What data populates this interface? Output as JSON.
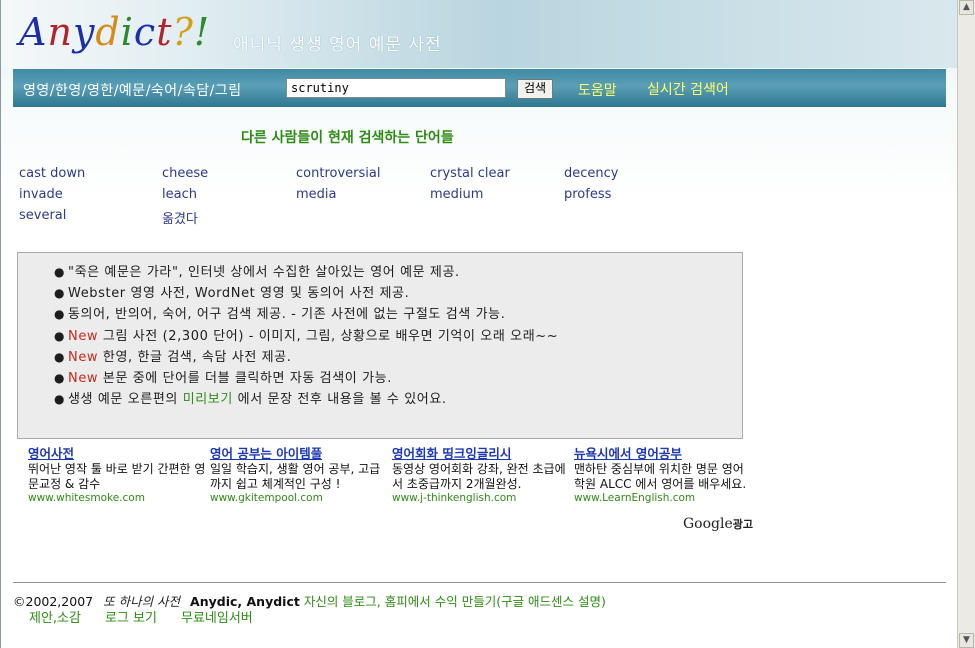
{
  "header": {
    "logo": [
      "A",
      "n",
      "y",
      "d",
      "i",
      "c",
      "t",
      "?",
      "!"
    ],
    "logo_colors": [
      "#1c2fa8",
      "#b1252a",
      "#1c2fa8",
      "#d58b18",
      "#2b8a2b",
      "#1c2fa8",
      "#b1252a",
      "#d5a018",
      "#2b8a2b"
    ],
    "tagline": "애니닉 생생 영어 예문 사전"
  },
  "nav": {
    "categories": "영영/한영/영한/예문/숙어/속담/그림",
    "search_value": "scrutiny",
    "search_button": "검색",
    "help": "도움말",
    "live_search": "실시간 검색어"
  },
  "others": {
    "title": "다른 사람들이 현재 검색하는 단어들",
    "words": [
      [
        "cast down",
        "cheese",
        "controversial",
        "crystal clear",
        "decency"
      ],
      [
        "invade",
        "leach",
        "media",
        "medium",
        "profess"
      ],
      [
        "several",
        "옮겼다"
      ]
    ]
  },
  "features": [
    {
      "prefix": "",
      "text": "\"죽은 예문은 가라\", 인터넷 상에서 수집한 살아있는 영어 예문 제공."
    },
    {
      "prefix": "",
      "text": "Webster 영영 사전, WordNet 영영 및 동의어 사전 제공."
    },
    {
      "prefix": "",
      "text": "동의어, 반의어, 숙어, 어구 검색 제공. - 기존 사전에 없는 구절도 검색 가능."
    },
    {
      "prefix": "New",
      "text": " 그림 사전 (2,300 단어) - 이미지, 그림, 상황으로 배우면 기억이 오래 오래~~"
    },
    {
      "prefix": "New",
      "text": " 한영, 한글 검색, 속담 사전 제공."
    },
    {
      "prefix": "New",
      "text": " 본문 중에 단어를 더블 클릭하면 자동 검색이 가능."
    }
  ],
  "feature_last": {
    "before": "생생 예문 오른편의 ",
    "link": "미리보기",
    "after": " 에서 문장 전후 내용을 볼 수 있어요."
  },
  "ads": [
    {
      "title": "영어사전",
      "body": "뛰어난 영작 툴 바로 받기 간편한 영문교정 & 감수",
      "url": "www.whitesmoke.com"
    },
    {
      "title": "영어 공부는 아이템풀",
      "body": "일일 학습지, 생활 영어 공부, 고급까지 쉽고 체계적인 구성 !",
      "url": "www.gkitempool.com"
    },
    {
      "title": "영어회화 띵크잉글리시",
      "body": "동영상 영어회화 강좌, 완전 초급에서 초중급까지 2개월완성.",
      "url": "www.j-thinkenglish.com"
    },
    {
      "title": "뉴욕시에서 영어공부",
      "body": "맨하탄 중심부에 위치한 명문 영어 학원 ALCC 에서 영어를 배우세요.",
      "url": "www.LearnEnglish.com"
    }
  ],
  "google_ads": {
    "brand": "Google",
    "label": "광고"
  },
  "footer": {
    "copyright": "©2002,2007",
    "tagline": "또 하나의 사전",
    "brand": "Anydic, Anydict",
    "blog_link": "자신의 블로그, 홈피에서 수익 만들기(구글 애드센스 설명)",
    "links": [
      "제안,소감",
      "로그 보기",
      "무료네임서버"
    ]
  }
}
